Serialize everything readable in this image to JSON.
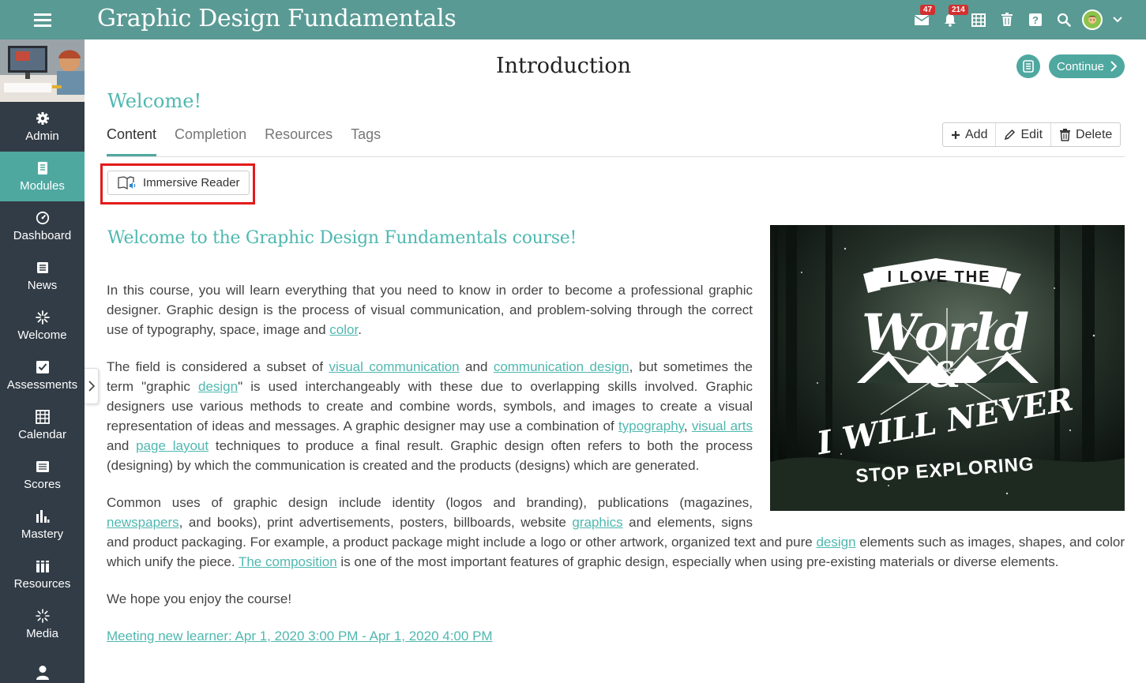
{
  "app": {
    "title": "Graphic Design Fundamentals"
  },
  "topbar": {
    "messages_count": "47",
    "notifications_count": "214",
    "icons": [
      "mail-icon",
      "bell-icon",
      "calendar-grid-icon",
      "trash-icon",
      "help-icon",
      "search-icon",
      "avatar",
      "chevron-down-icon"
    ]
  },
  "sidebar": {
    "items": [
      {
        "label": "Admin",
        "icon": "gear-icon",
        "active": false
      },
      {
        "label": "Modules",
        "icon": "modules-icon",
        "active": true
      },
      {
        "label": "Dashboard",
        "icon": "dashboard-icon",
        "active": false
      },
      {
        "label": "News",
        "icon": "news-icon",
        "active": false
      },
      {
        "label": "Welcome",
        "icon": "welcome-icon",
        "active": false
      },
      {
        "label": "Assessments",
        "icon": "checkbox-icon",
        "active": false
      },
      {
        "label": "Calendar",
        "icon": "calendar-icon",
        "active": false
      },
      {
        "label": "Scores",
        "icon": "scores-icon",
        "active": false
      },
      {
        "label": "Mastery",
        "icon": "bar-chart-icon",
        "active": false
      },
      {
        "label": "Resources",
        "icon": "resources-icon",
        "active": false
      },
      {
        "label": "Media",
        "icon": "media-icon",
        "active": false
      },
      {
        "label": "",
        "icon": "user-icon",
        "active": false
      }
    ]
  },
  "page": {
    "title": "Introduction",
    "continue_label": "Continue",
    "section_title": "Welcome!"
  },
  "tabs": [
    {
      "label": "Content",
      "active": true
    },
    {
      "label": "Completion",
      "active": false
    },
    {
      "label": "Resources",
      "active": false
    },
    {
      "label": "Tags",
      "active": false
    }
  ],
  "actions": {
    "add": "Add",
    "edit": "Edit",
    "delete": "Delete"
  },
  "immersive_reader": "Immersive Reader",
  "content": {
    "heading": "Welcome to the Graphic Design Fundamentals course!",
    "p1_a": "In this course, you will learn everything that you need to know in order to become a professional graphic designer. Graphic design is the process of visual communication, and problem-solving through the correct use of typography, space, image and ",
    "p1_link": "color",
    "p1_b": ".",
    "p2_a": "The field is considered a subset of ",
    "p2_link1": "visual communication",
    "p2_b": " and ",
    "p2_link2": "communication design",
    "p2_c": ", but sometimes the term \"graphic ",
    "p2_link3": "design",
    "p2_d": "\" is used interchangeably with these due to overlapping skills involved. Graphic designers use various methods to create and combine words, symbols, and images to create a visual representation of ideas and messages. A graphic designer may use a combination of ",
    "p2_link4": "typography",
    "p2_e": ", ",
    "p2_link5": "visual arts",
    "p2_f": " and ",
    "p2_link6": "page layout",
    "p2_g": " techniques to produce a final result. Graphic design often refers to both the process (designing) by which the communication is created and the products (designs) which are generated.",
    "p3_a": "Common uses of graphic design include identity (logos and branding), publications (magazines, ",
    "p3_link1": "newspapers",
    "p3_b": ", and books), print advertisements, posters, billboards, website ",
    "p3_link2": "graphics",
    "p3_c": " and elements, signs and product packaging. For example, a product package might include a logo or other artwork, organized text and pure ",
    "p3_link3": "design",
    "p3_d": " elements such as images, shapes, and color which unify the piece. ",
    "p3_link4": "The composition",
    "p3_e": " is one of the most important features of graphic design, especially when using pre-existing materials or diverse elements.",
    "p4": "We hope you enjoy the course!",
    "meeting_link": "Meeting new learner: Apr 1, 2020 3:00 PM - Apr 1, 2020 4:00 PM"
  },
  "hero_image": {
    "line1": "I LOVE THE",
    "line2": "World",
    "line3": "&",
    "line4": "I WILL NEVER",
    "line5": "STOP EXPLORING"
  },
  "colors": {
    "topbar": "#5a9a94",
    "sidebar": "#323c46",
    "accent": "#4fa8a0",
    "link": "#4fb8b0",
    "highlight": "#e31b1b"
  }
}
